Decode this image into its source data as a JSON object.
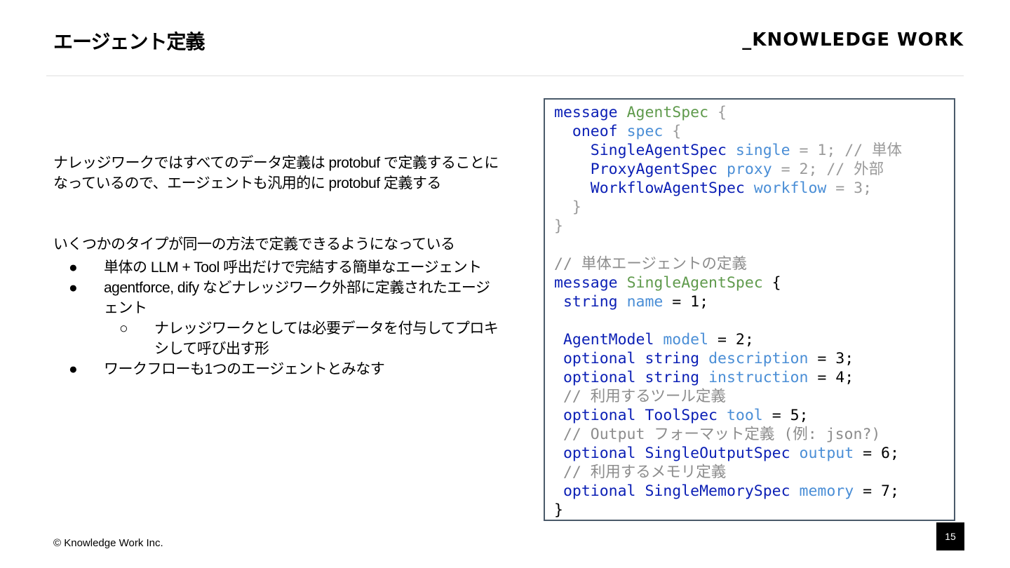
{
  "header": {
    "title": "エージェント定義",
    "brand": "_KNOWLEDGE WORK"
  },
  "body": {
    "paragraph1": "ナレッジワークではすべてのデータ定義は protobuf で定義することになっているので、エージェントも汎用的に protobuf 定義する",
    "paragraph2": "いくつかのタイプが同一の方法で定義できるようになっている",
    "bullet_marker": "●",
    "sub_bullet_marker": "○",
    "bullets": [
      "単体の LLM + Tool 呼出だけで完結する簡単なエージェント",
      "agentforce, dify などナレッジワーク外部に定義されたエージェント",
      "ワークフローも1つのエージェントとみなす"
    ],
    "sub_bullets": [
      "ナレッジワークとしては必要データを付与してプロキシして呼び出す形"
    ]
  },
  "code": {
    "lines": [
      [
        {
          "t": "message ",
          "c": "kw"
        },
        {
          "t": "AgentSpec ",
          "c": "ty"
        },
        {
          "t": "{",
          "c": "pg"
        }
      ],
      [
        {
          "t": "  oneof ",
          "c": "kw"
        },
        {
          "t": "spec ",
          "c": "fd"
        },
        {
          "t": "{",
          "c": "pg"
        }
      ],
      [
        {
          "t": "    SingleAgentSpec ",
          "c": "kw"
        },
        {
          "t": "single ",
          "c": "fd"
        },
        {
          "t": "= 1; // 単体",
          "c": "pg"
        }
      ],
      [
        {
          "t": "    ProxyAgentSpec ",
          "c": "kw"
        },
        {
          "t": "proxy ",
          "c": "fd"
        },
        {
          "t": "= 2; // 外部",
          "c": "pg"
        }
      ],
      [
        {
          "t": "    WorkflowAgentSpec ",
          "c": "kw"
        },
        {
          "t": "workflow ",
          "c": "fd"
        },
        {
          "t": "= 3;",
          "c": "pg"
        }
      ],
      [
        {
          "t": "  }",
          "c": "pg"
        }
      ],
      [
        {
          "t": "}",
          "c": "pg"
        }
      ],
      [
        {
          "t": "",
          "c": "pn"
        }
      ],
      [
        {
          "t": "// 単体エージェントの定義",
          "c": "cm"
        }
      ],
      [
        {
          "t": "message ",
          "c": "kw"
        },
        {
          "t": "SingleAgentSpec ",
          "c": "ty"
        },
        {
          "t": "{",
          "c": "pn"
        }
      ],
      [
        {
          "t": " string ",
          "c": "kw"
        },
        {
          "t": "name ",
          "c": "fd"
        },
        {
          "t": "= 1;",
          "c": "pn"
        }
      ],
      [
        {
          "t": "",
          "c": "pn"
        }
      ],
      [
        {
          "t": " AgentModel ",
          "c": "kw"
        },
        {
          "t": "model ",
          "c": "fd"
        },
        {
          "t": "= 2;",
          "c": "pn"
        }
      ],
      [
        {
          "t": " optional string ",
          "c": "kw"
        },
        {
          "t": "description ",
          "c": "fd"
        },
        {
          "t": "= 3;",
          "c": "pn"
        }
      ],
      [
        {
          "t": " optional string ",
          "c": "kw"
        },
        {
          "t": "instruction ",
          "c": "fd"
        },
        {
          "t": "= 4;",
          "c": "pn"
        }
      ],
      [
        {
          "t": " // 利用するツール定義",
          "c": "cm"
        }
      ],
      [
        {
          "t": " optional ToolSpec ",
          "c": "kw"
        },
        {
          "t": "tool ",
          "c": "fd"
        },
        {
          "t": "= 5;",
          "c": "pn"
        }
      ],
      [
        {
          "t": " // Output フォーマット定義 (例: json?)",
          "c": "cm"
        }
      ],
      [
        {
          "t": " optional SingleOutputSpec ",
          "c": "kw"
        },
        {
          "t": "output ",
          "c": "fd"
        },
        {
          "t": "= 6;",
          "c": "pn"
        }
      ],
      [
        {
          "t": " // 利用するメモリ定義",
          "c": "cm"
        }
      ],
      [
        {
          "t": " optional SingleMemorySpec ",
          "c": "kw"
        },
        {
          "t": "memory ",
          "c": "fd"
        },
        {
          "t": "= 7;",
          "c": "pn"
        }
      ],
      [
        {
          "t": "}",
          "c": "pn"
        }
      ]
    ]
  },
  "footer": {
    "copyright": "© Knowledge Work Inc.",
    "page_number": "15"
  },
  "colors": {
    "keyword": "#0b1fb5",
    "type_name": "#5f9a4c",
    "field": "#4a8ed6",
    "comment": "#8c8c8c",
    "code_border": "#4a5a6a"
  }
}
